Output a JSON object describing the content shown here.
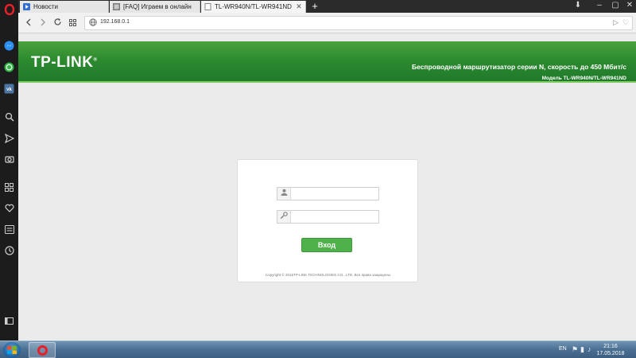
{
  "browser": {
    "tabs": [
      {
        "label": "Новости",
        "active": false
      },
      {
        "label": "[FAQ] Играем в онлайн",
        "active": false
      },
      {
        "label": "TL-WR940N/TL-WR941ND",
        "active": true
      }
    ],
    "new_tab_label": "+",
    "address": "192.168.0.1"
  },
  "sidebar": {
    "icons": [
      "opera-icon",
      "messenger-icon",
      "whatsapp-icon",
      "vk-icon",
      "search-icon",
      "send-icon",
      "camera-icon",
      "speed-dial-icon",
      "heart-icon",
      "news-icon",
      "history-icon",
      "sidebar-toggle-icon"
    ]
  },
  "page": {
    "logo": "TP-LINK",
    "logo_mark": "®",
    "header_title": "Беспроводной маршрутизатор серии N, скорость до 450 Мбит/с",
    "header_model": "Модель TL-WR940N/TL-WR941ND",
    "login": {
      "username_value": "",
      "password_value": "",
      "button_label": "Вход",
      "copyright": "Copyright © 2015TP-LINK TECHNOLOGIES CO., LTD. Все права защищены."
    }
  },
  "taskbar": {
    "language": "EN",
    "time": "21:16",
    "date": "17.05.2018"
  },
  "colors": {
    "header_green": "#2d8b2f",
    "button_green": "#4fb14a",
    "opera_red": "#e8202a"
  }
}
